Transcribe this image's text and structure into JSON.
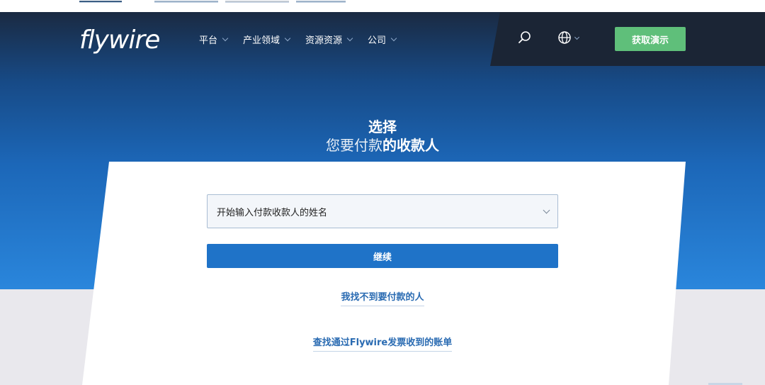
{
  "header": {
    "logo": "flywire",
    "nav": [
      {
        "label": "平台"
      },
      {
        "label": "产业领域"
      },
      {
        "label": "资源资源"
      },
      {
        "label": "公司"
      }
    ],
    "demo_button": "获取演示"
  },
  "hero": {
    "title": "选择",
    "subtitle_light": "您要付款",
    "subtitle_bold": "的收款人"
  },
  "form": {
    "select_placeholder": "开始输入付款收款人的姓名",
    "continue_button": "继续",
    "link_not_found": "我找不到要付款的人",
    "link_invoice": "查找通过Flywire发票收到的账单"
  },
  "colors": {
    "accent_green": "#5fbf7a",
    "primary_blue": "#1f73c8",
    "link_blue": "#2a6bb2",
    "header_dark": "#1b2535"
  }
}
